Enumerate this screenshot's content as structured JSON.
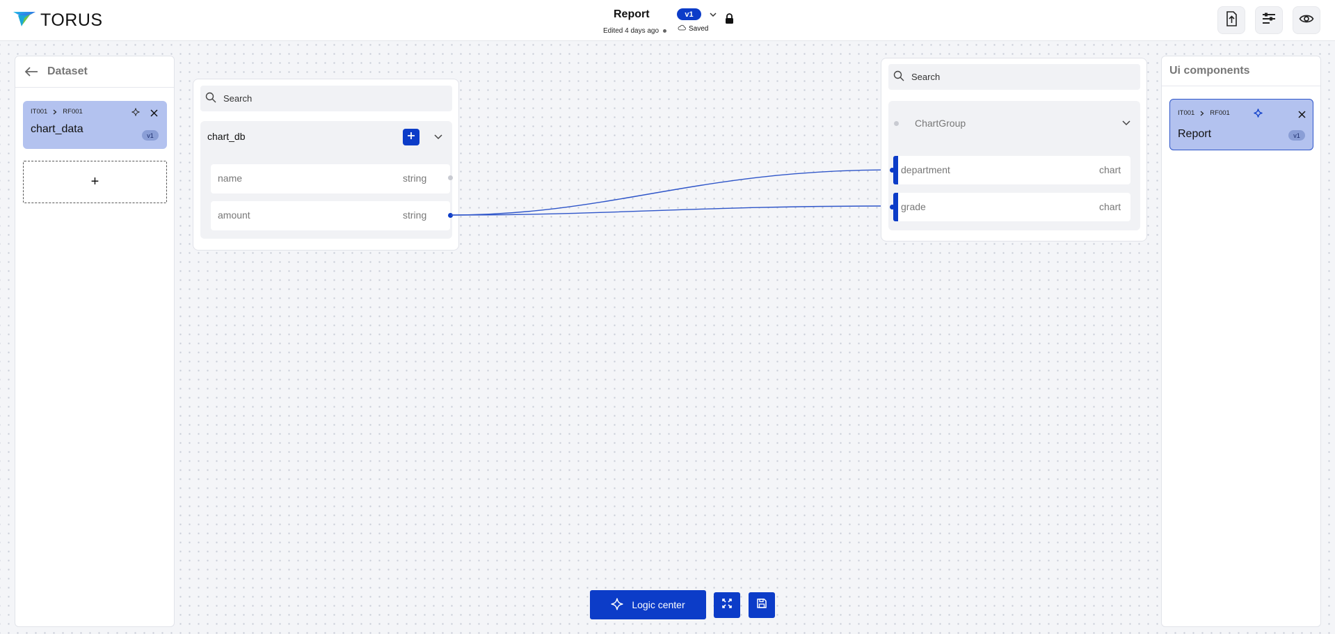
{
  "brand": {
    "name": "TORUS"
  },
  "document": {
    "title": "Report",
    "edited": "Edited 4 days ago",
    "version": "v1",
    "status": "Saved"
  },
  "left_panel": {
    "title": "Dataset",
    "item": {
      "crumb_a": "IT001",
      "crumb_b": "RF001",
      "name": "chart_data",
      "version": "v1"
    },
    "add_label": "+"
  },
  "source_node": {
    "search_placeholder": "Search",
    "group_name": "chart_db",
    "fields": [
      {
        "name": "name",
        "type": "string"
      },
      {
        "name": "amount",
        "type": "string"
      }
    ]
  },
  "target_node": {
    "search_placeholder": "Search",
    "group_name": "ChartGroup",
    "fields": [
      {
        "name": "department",
        "type": "chart"
      },
      {
        "name": "grade",
        "type": "chart"
      }
    ]
  },
  "right_panel": {
    "title": "Ui components",
    "item": {
      "crumb_a": "IT001",
      "crumb_b": "RF001",
      "name": "Report",
      "version": "v1"
    }
  },
  "toolbar": {
    "logic_center": "Logic center"
  },
  "colors": {
    "accent": "#0c3cc8",
    "card": "#b3c2ef",
    "canvas": "#f4f5f8"
  },
  "icons": [
    "logo-icon",
    "chevron-down-icon",
    "lock-icon",
    "cloud-icon",
    "upload-icon",
    "sliders-icon",
    "eye-icon",
    "back-arrow-icon",
    "sparkle-icon",
    "close-icon",
    "search-icon",
    "plus-icon",
    "expand-icon",
    "save-icon"
  ]
}
